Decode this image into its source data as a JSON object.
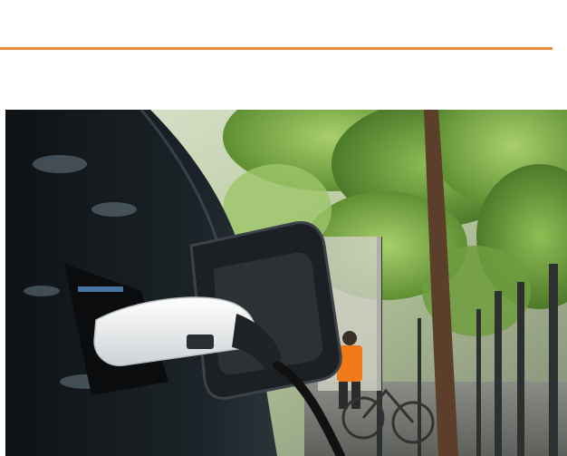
{
  "header": {
    "accent_color": "#ee8a35"
  },
  "photo": {
    "subject": "electric-car-charging-photo",
    "colors": {
      "car_body": "#151a1e",
      "foliage": "#7fae4c",
      "charger_plug": "#f2f2f2",
      "hi_vis_vest": "#f07a1a"
    }
  }
}
